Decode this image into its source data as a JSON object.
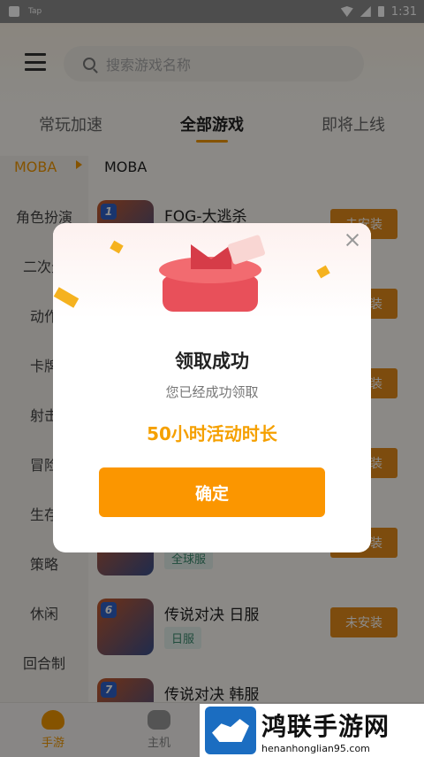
{
  "statusbar": {
    "app_label": "Tap",
    "time": "1:31"
  },
  "search": {
    "placeholder": "搜索游戏名称"
  },
  "tabs": [
    "常玩加速",
    "全部游戏",
    "即将上线"
  ],
  "sidebar": {
    "active": "MOBA",
    "items": [
      "角色扮演",
      "二次元",
      "动作",
      "卡牌",
      "射击",
      "冒险",
      "生存",
      "策略",
      "休闲",
      "回合制"
    ]
  },
  "main": {
    "section_title": "MOBA",
    "games": [
      {
        "badge": "1",
        "name": "FOG-大逃杀",
        "tag": "",
        "button": "未安装"
      },
      {
        "badge": "",
        "name": "",
        "tag": "",
        "button": "未安装"
      },
      {
        "badge": "",
        "name": "",
        "tag": "",
        "button": "未安装"
      },
      {
        "badge": "",
        "name": "",
        "tag": "",
        "button": "未安装"
      },
      {
        "badge": "",
        "name": "",
        "tag": "全球服",
        "button": "未安装"
      },
      {
        "badge": "6",
        "name": "传说对决 日服",
        "tag": "日服",
        "button": "未安装"
      },
      {
        "badge": "7",
        "name": "传说对决 韩服",
        "tag": "",
        "button": ""
      }
    ]
  },
  "bottomnav": {
    "mobile_label": "手游",
    "console_label": "主机"
  },
  "dialog": {
    "title": "领取成功",
    "subtitle": "您已经成功领取",
    "reward": "50小时活动时长",
    "confirm_label": "确定"
  },
  "watermark": {
    "brand": "鸿联手游网",
    "url": "henanhonglian95.com"
  }
}
